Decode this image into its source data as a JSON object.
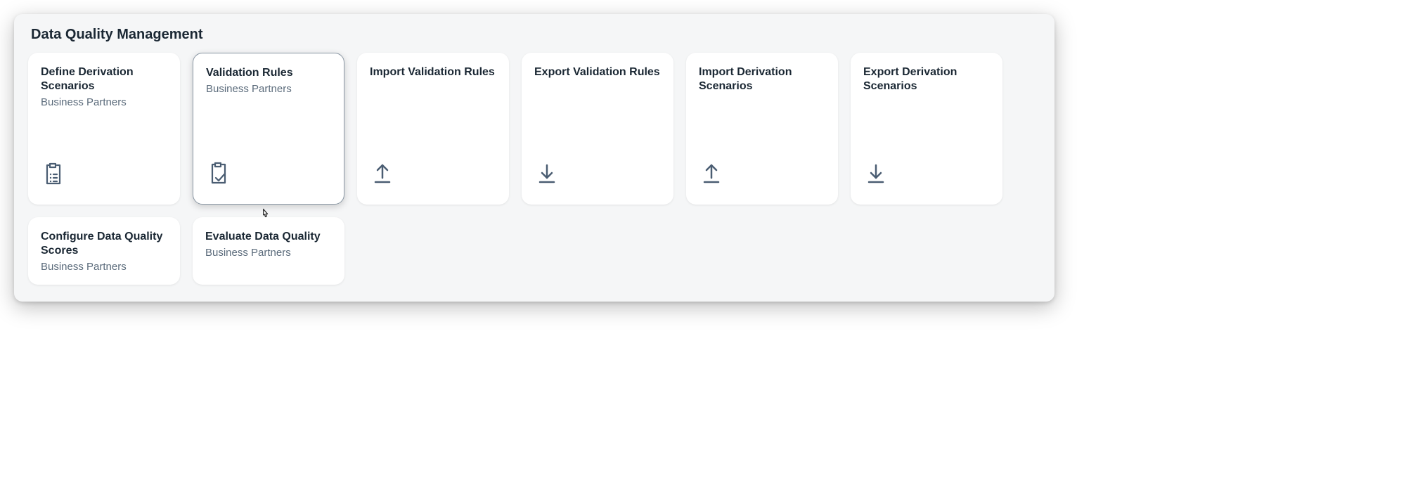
{
  "section": {
    "title": "Data Quality Management"
  },
  "tiles": [
    {
      "title": "Define Derivation Scenarios",
      "subtitle": "Business Partners",
      "icon": "clipboard-list-icon"
    },
    {
      "title": "Validation Rules",
      "subtitle": "Business Partners",
      "icon": "clipboard-check-icon"
    },
    {
      "title": "Import Validation Rules",
      "subtitle": "",
      "icon": "upload-icon"
    },
    {
      "title": "Export Validation Rules",
      "subtitle": "",
      "icon": "download-icon"
    },
    {
      "title": "Import Derivation Scenarios",
      "subtitle": "",
      "icon": "upload-icon"
    },
    {
      "title": "Export Derivation Scenarios",
      "subtitle": "",
      "icon": "download-icon"
    },
    {
      "title": "Configure Data Quality Scores",
      "subtitle": "Business Partners",
      "icon": ""
    },
    {
      "title": "Evaluate Data Quality",
      "subtitle": "Business Partners",
      "icon": ""
    }
  ]
}
